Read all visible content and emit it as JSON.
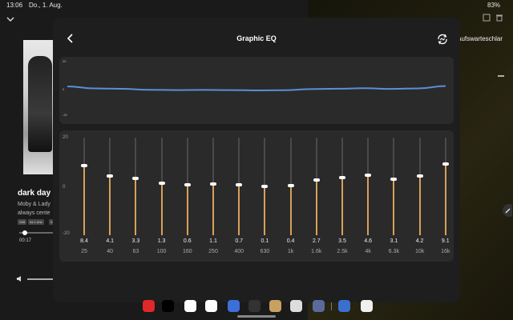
{
  "status": {
    "time": "13:06",
    "date": "Do., 1. Aug.",
    "battery": "83%"
  },
  "background_app": {
    "track_title": "dark day",
    "artist": "Moby & Lady",
    "album": "always cente",
    "tags": [
      "24B",
      "44.1 kHz",
      "3"
    ],
    "elapsed": "00:17",
    "queue_label": "aufswarteschlar",
    "playback_progress": 0.1
  },
  "modal": {
    "title": "Graphic EQ",
    "curve_axis": {
      "top": "20",
      "mid": "0",
      "bottom": "-20"
    },
    "slider_axis": {
      "top": "20",
      "mid": "0",
      "bottom": "-20"
    },
    "bands": [
      {
        "freq": "25",
        "gain": "8.4"
      },
      {
        "freq": "40",
        "gain": "4.1"
      },
      {
        "freq": "63",
        "gain": "3.3"
      },
      {
        "freq": "100",
        "gain": "1.3"
      },
      {
        "freq": "160",
        "gain": "0.6"
      },
      {
        "freq": "250",
        "gain": "1.1"
      },
      {
        "freq": "400",
        "gain": "0.7"
      },
      {
        "freq": "630",
        "gain": "0.1"
      },
      {
        "freq": "1k",
        "gain": "0.4"
      },
      {
        "freq": "1.6k",
        "gain": "2.7"
      },
      {
        "freq": "2.5k",
        "gain": "3.5"
      },
      {
        "freq": "4k",
        "gain": "4.6"
      },
      {
        "freq": "6.3k",
        "gain": "3.1"
      },
      {
        "freq": "10k",
        "gain": "4.2"
      },
      {
        "freq": "16k",
        "gain": "9.1"
      }
    ]
  },
  "colors": {
    "accent": "#d7a05a",
    "curve": "#5b8fd8",
    "panel": "#2a2a2a",
    "modal": "#1e1e1e"
  },
  "dock_apps": [
    {
      "name": "flipboard-icon",
      "color": "#e02828"
    },
    {
      "name": "sonos-icon",
      "color": "#000000"
    },
    {
      "name": "chrome-icon",
      "color": "#ffffff"
    },
    {
      "name": "gmail-icon",
      "color": "#ffffff"
    },
    {
      "name": "blue-app-icon",
      "color": "#3d6fd9"
    },
    {
      "name": "dark-app-icon",
      "color": "#333333"
    },
    {
      "name": "photo-app-icon",
      "color": "#c8a060"
    },
    {
      "name": "radio-app-icon",
      "color": "#dddddd"
    },
    {
      "name": "app-drawer-icon",
      "color": "#5a6a9a"
    },
    {
      "name": "settings-app-icon",
      "color": "#3a6fd0"
    },
    {
      "name": "white-app-icon",
      "color": "#f0f0f0"
    }
  ]
}
